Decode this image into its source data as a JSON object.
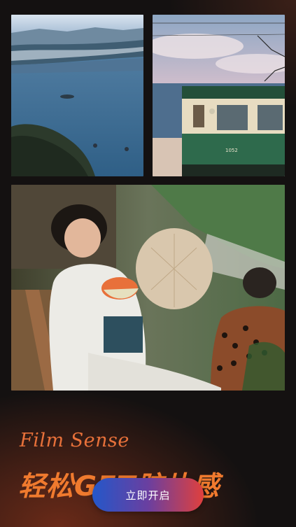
{
  "photos": [
    {
      "name": "sea-coast-photo"
    },
    {
      "name": "tram-seaside-photo",
      "car_number": "1052"
    },
    {
      "name": "girl-watermelon-photo"
    }
  ],
  "caption": {
    "english": "Film Sense",
    "headline": "轻松GET胶片感"
  },
  "cta": {
    "label": "立即开启"
  },
  "colors": {
    "background": "#141111",
    "accent_orange": "#f07a2e",
    "button_gradient_start": "#2457c9",
    "button_gradient_end": "#e0403d"
  }
}
